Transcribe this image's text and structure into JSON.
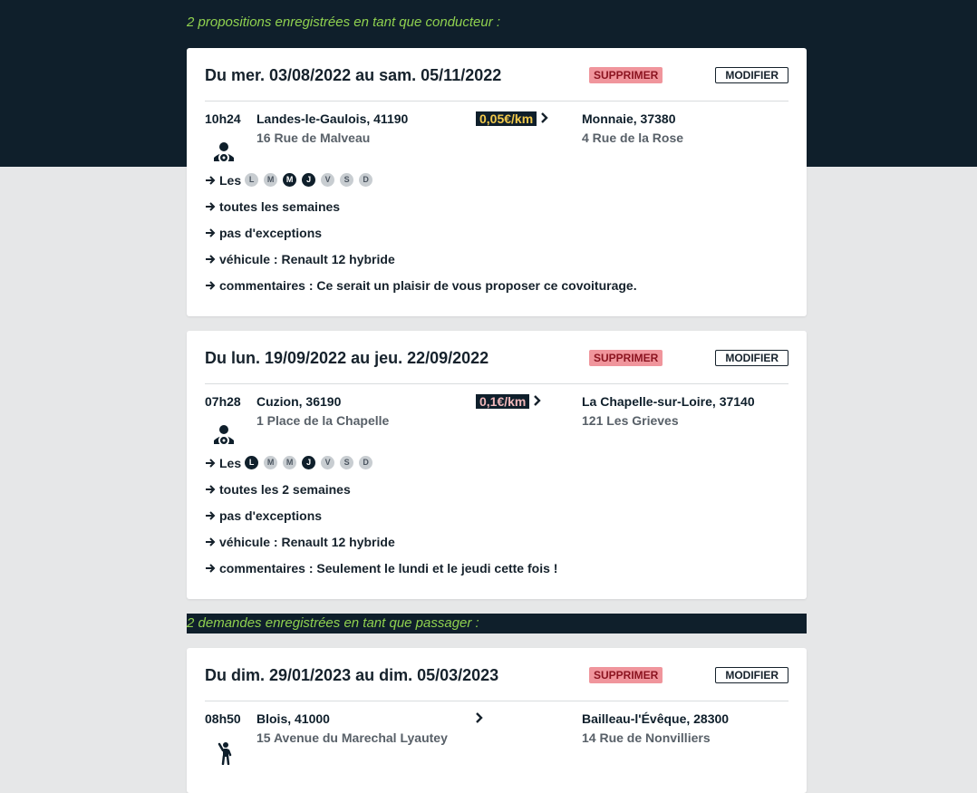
{
  "sections": {
    "driver_heading": "2 propositions enregistrées en tant que conducteur :",
    "passenger_heading": "2 demandes enregistrées en tant que passager :"
  },
  "buttons": {
    "delete": "SUPPRIMER",
    "edit": "MODIFIER"
  },
  "labels": {
    "days_prefix": "Les"
  },
  "colors": {
    "navy": "#0f1f2b",
    "green": "#8fd14f",
    "delete_bg": "#f0959c",
    "price_yellow": "#f2c94c",
    "price_pink": "#f0b7ba"
  },
  "offers": [
    {
      "title": "Du mer. 03/08/2022 au sam. 05/11/2022",
      "time": "10h24",
      "role_icon": "driver-icon",
      "from_city": "Landes-le-Gaulois, 41190",
      "from_address": "16 Rue de Malveau",
      "price": "0,05€/km",
      "to_city": "Monnaie, 37380",
      "to_address": "4 Rue de la Rose",
      "days": [
        {
          "l": "L",
          "on": false
        },
        {
          "l": "M",
          "on": false
        },
        {
          "l": "M",
          "on": true
        },
        {
          "l": "J",
          "on": true
        },
        {
          "l": "V",
          "on": false
        },
        {
          "l": "S",
          "on": false
        },
        {
          "l": "D",
          "on": false
        }
      ],
      "frequency": "toutes les semaines",
      "exceptions": "pas d'exceptions",
      "vehicle": "véhicule : Renault 12 hybride",
      "comments": "commentaires : Ce serait un plaisir de vous proposer ce covoiturage."
    },
    {
      "title": "Du lun. 19/09/2022 au jeu. 22/09/2022",
      "time": "07h28",
      "role_icon": "driver-icon",
      "from_city": "Cuzion, 36190",
      "from_address": "1 Place de la Chapelle",
      "price": "0,1€/km",
      "to_city": "La Chapelle-sur-Loire, 37140",
      "to_address": "121 Les Grieves",
      "days": [
        {
          "l": "L",
          "on": true
        },
        {
          "l": "M",
          "on": false
        },
        {
          "l": "M",
          "on": false
        },
        {
          "l": "J",
          "on": true
        },
        {
          "l": "V",
          "on": false
        },
        {
          "l": "S",
          "on": false
        },
        {
          "l": "D",
          "on": false
        }
      ],
      "frequency": "toutes les 2 semaines",
      "exceptions": "pas d'exceptions",
      "vehicle": "véhicule : Renault 12 hybride",
      "comments": "commentaires : Seulement le lundi et le jeudi cette fois !"
    }
  ],
  "requests": [
    {
      "title": "Du dim. 29/01/2023 au dim. 05/03/2023",
      "time": "08h50",
      "role_icon": "hitchhiker-icon",
      "from_city": "Blois, 41000",
      "from_address": "15 Avenue du Marechal Lyautey",
      "to_city": "Bailleau-l'Évêque, 28300",
      "to_address": "14 Rue de Nonvilliers"
    }
  ]
}
